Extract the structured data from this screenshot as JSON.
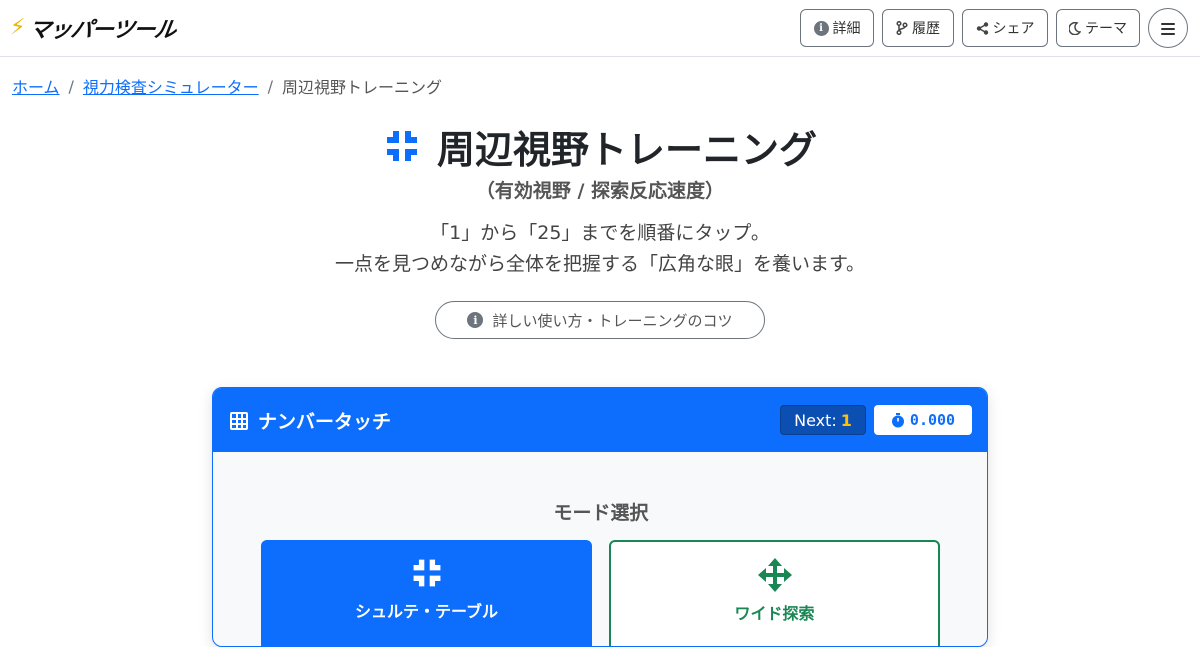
{
  "brand": {
    "name": "マッパーツール",
    "icon": "lightning-bolt-icon"
  },
  "header": {
    "buttons": [
      {
        "label": "詳細",
        "icon": "info-circle-icon"
      },
      {
        "label": "履歴",
        "icon": "branch-icon"
      },
      {
        "label": "シェア",
        "icon": "share-icon"
      },
      {
        "label": "テーマ",
        "icon": "moon-icon"
      }
    ],
    "menu_icon": "hamburger-menu-icon"
  },
  "breadcrumb": {
    "items": [
      "ホーム",
      "視力検査シミュレーター",
      "周辺視野トレーニング"
    ],
    "separator": "/"
  },
  "page": {
    "title": "周辺視野トレーニング",
    "subtitle": "（有効視野 / 探索反応速度）",
    "description_line1": "「1」から「25」までを順番にタップ。",
    "description_line2": "一点を見つめながら全体を把握する「広角な眼」を養います。",
    "howto_label": "詳しい使い方・トレーニングのコツ"
  },
  "game": {
    "title": "ナンバータッチ",
    "next_label": "Next:",
    "next_value": "1",
    "timer": "0.000",
    "mode_label": "モード選択",
    "modes": [
      {
        "name": "シュルテ・テーブル",
        "icon": "compress-icon",
        "selected": true
      },
      {
        "name": "ワイド探索",
        "icon": "arrows-move-icon",
        "selected": false
      }
    ]
  },
  "colors": {
    "primary": "#0d6efd",
    "success": "#198754",
    "warning": "#ffc107"
  }
}
